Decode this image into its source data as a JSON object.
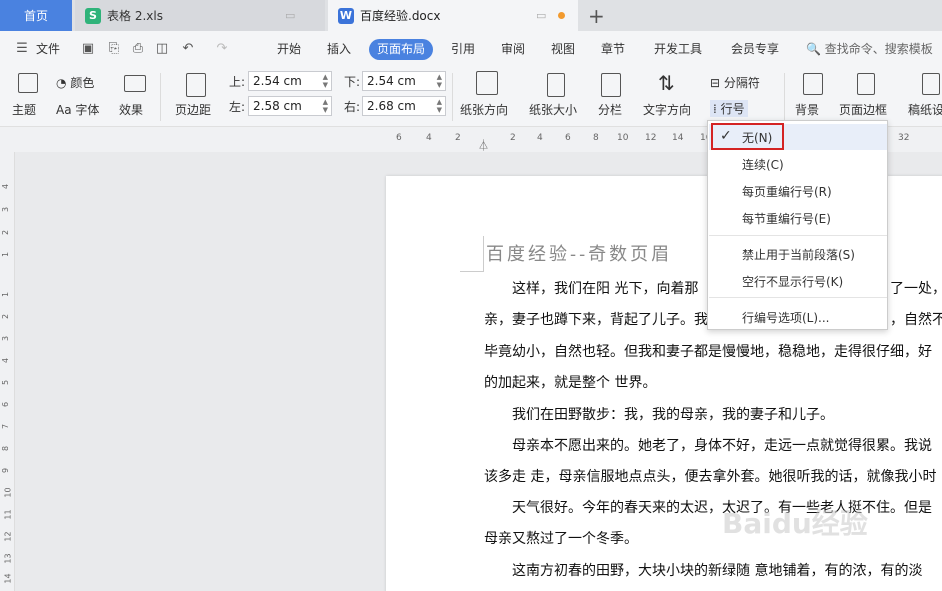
{
  "tabs": {
    "home": "首页",
    "xls": "表格 2.xls",
    "doc": "百度经验.docx"
  },
  "menubar": {
    "file": "文件",
    "items": [
      "开始",
      "插入",
      "页面布局",
      "引用",
      "审阅",
      "视图",
      "章节",
      "开发工具",
      "会员专享"
    ],
    "search": "查找命令、搜索模板"
  },
  "ribbon": {
    "theme": "主题",
    "color": "颜色",
    "font": "字体",
    "effect": "效果",
    "margins": "页边距",
    "top_label": "上:",
    "top_value": "2.54 cm",
    "bottom_label": "下:",
    "bottom_value": "2.54 cm",
    "left_label": "左:",
    "left_value": "2.58 cm",
    "right_label": "右:",
    "right_value": "2.68 cm",
    "orientation": "纸张方向",
    "size": "纸张大小",
    "columns": "分栏",
    "text_dir": "文字方向",
    "breaks": "分隔符",
    "line_numbers": "行号",
    "background": "背景",
    "page_border": "页面边框",
    "draft": "稿纸设"
  },
  "ruler_top": [
    "6",
    "4",
    "2",
    "2",
    "4",
    "6",
    "8",
    "10",
    "12",
    "14",
    "16",
    "18",
    "32"
  ],
  "ruler_left": [
    "4",
    "3",
    "2",
    "1",
    "1",
    "2",
    "3",
    "4",
    "5",
    "6",
    "7",
    "8",
    "9",
    "10",
    "11",
    "12",
    "13",
    "14",
    "15"
  ],
  "document": {
    "heading": "百度经验--奇数页眉",
    "lines": [
      "　　这样，我们在阳 光下，向着那",
      "亲，妻子也蹲下来，背起了儿子。我",
      "毕竟幼小，自然也轻。但我和妻子都是慢慢地，稳稳地，走得很仔细，好",
      "的加起来，就是整个 世界。",
      "　　我们在田野散步：我，我的母亲，我的妻子和儿子。",
      "　　母亲本不愿出来的。她老了，身体不好，走远一点就觉得很累。我说",
      "该多走 走，母亲信服地点点头，便去拿外套。她很听我的话，就像我小时",
      "　　天气很好。今年的春天来的太迟，太迟了。有一些老人挺不住。但是",
      "母亲又熬过了一个冬季。",
      "　　这南方初春的田野，大块小块的新绿随 意地铺着，有的浓，有的淡"
    ],
    "line1_tail": "了一处，",
    "line2_tail": "，自然不"
  },
  "dropdown": {
    "items": [
      "无(N)",
      "连续(C)",
      "每页重编行号(R)",
      "每节重编行号(E)",
      "禁止用于当前段落(S)",
      "空行不显示行号(K)",
      "行编号选项(L)..."
    ],
    "checked": "✓"
  },
  "watermark": "Baidu经验",
  "colors": {
    "accent": "#4a82e0",
    "highlight": "#d42323"
  }
}
